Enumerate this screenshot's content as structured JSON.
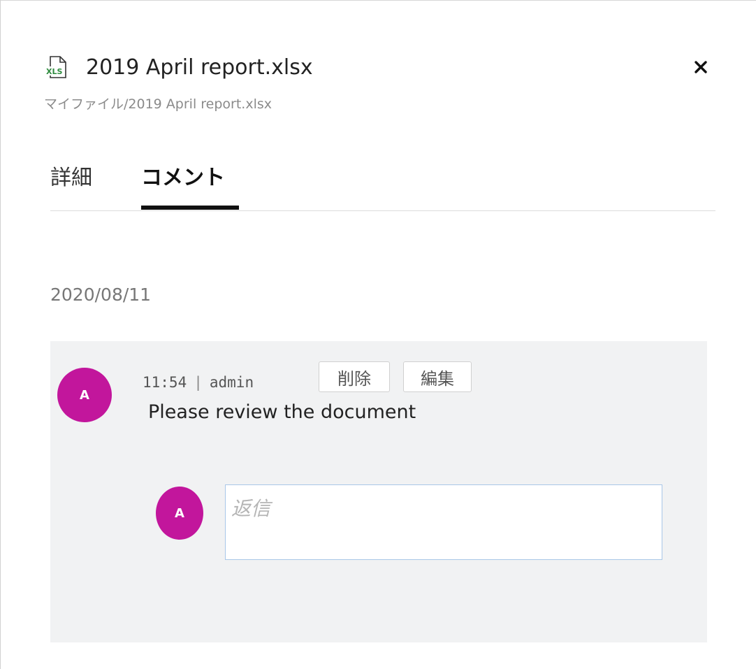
{
  "file": {
    "name": "2019 April report.xlsx",
    "icon": "xls-file-icon",
    "icon_label": "XLS",
    "icon_color": "#2e8b3e"
  },
  "breadcrumb": "マイファイル/2019 April report.xlsx",
  "tabs": [
    {
      "label": "詳細",
      "active": false
    },
    {
      "label": "コメント",
      "active": true
    }
  ],
  "comments": {
    "date": "2020/08/11",
    "item": {
      "avatar_initial": "A",
      "avatar_color": "#c2169c",
      "time": "11:54",
      "separator": "|",
      "author": "admin",
      "delete_label": "削除",
      "edit_label": "編集",
      "text": "Please review the document"
    },
    "reply": {
      "avatar_initial": "A",
      "placeholder": "返信",
      "value": ""
    }
  }
}
